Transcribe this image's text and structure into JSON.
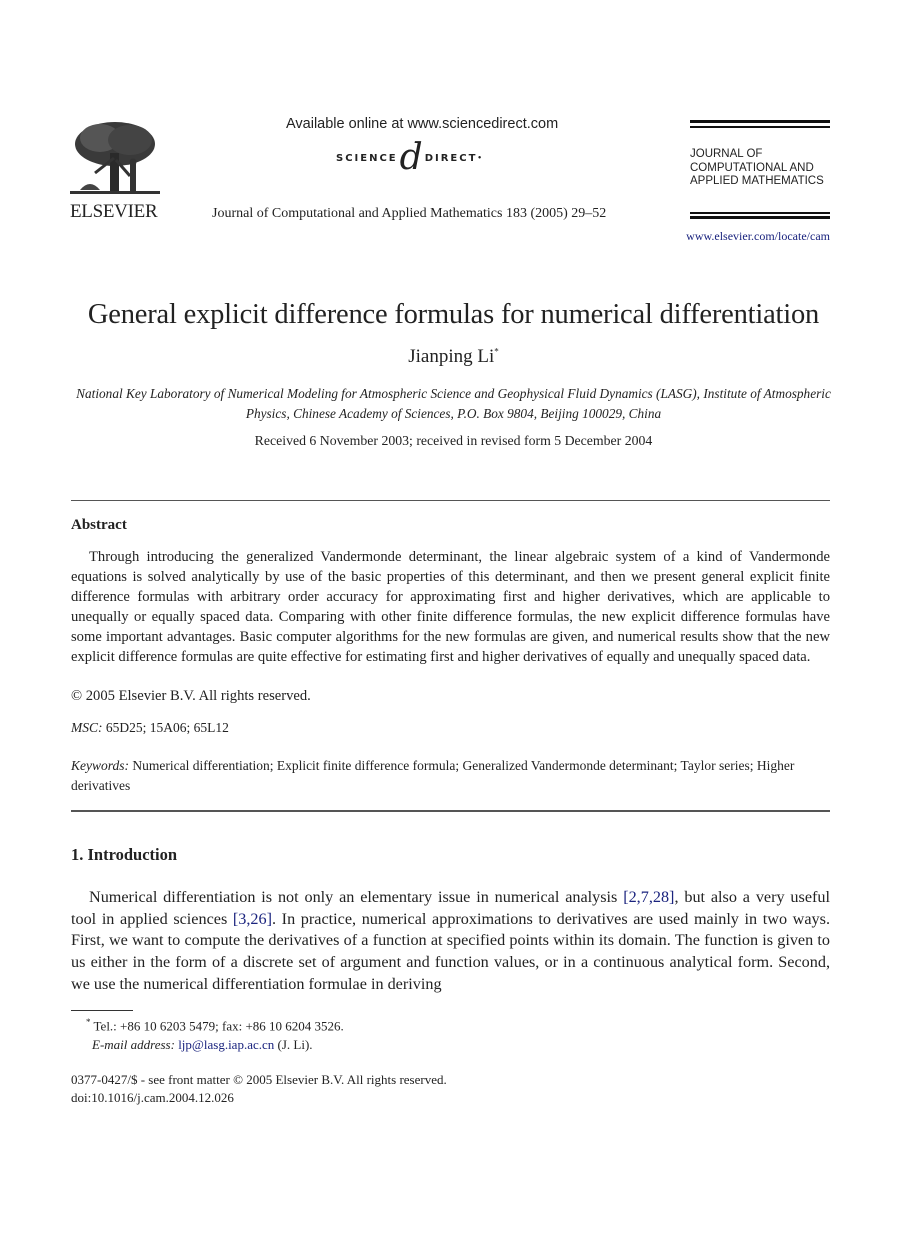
{
  "header": {
    "publisher": "ELSEVIER",
    "available_online": "Available online at www.sciencedirect.com",
    "sciencedirect_left": "SCIENCE",
    "sciencedirect_at": "d",
    "sciencedirect_right": "DIRECT",
    "sciencedirect_mark": "•",
    "journal_citation": "Journal of Computational and Applied Mathematics 183 (2005) 29–52",
    "journal_name_lines": [
      "JOURNAL OF",
      "COMPUTATIONAL AND",
      "APPLIED MATHEMATICS"
    ],
    "journal_url": "www.elsevier.com/locate/cam"
  },
  "paper": {
    "title": "General explicit difference formulas for numerical differentiation",
    "author": "Jianping Li",
    "author_mark": "*",
    "affiliation": "National Key Laboratory of Numerical Modeling for Atmospheric Science and Geophysical Fluid Dynamics (LASG), Institute of Atmospheric Physics, Chinese Academy of Sciences, P.O. Box 9804, Beijing 100029, China",
    "received": "Received 6 November 2003; received in revised form 5 December 2004"
  },
  "abstract": {
    "heading": "Abstract",
    "body": "Through introducing the generalized Vandermonde determinant, the linear algebraic system of a kind of Vandermonde equations is solved analytically by use of the basic properties of this determinant, and then we present general explicit finite difference formulas with arbitrary order accuracy for approximating first and higher derivatives, which are applicable to unequally or equally spaced data. Comparing with other finite difference formulas, the new explicit difference formulas have some important advantages. Basic computer algorithms for the new formulas are given, and numerical results show that the new explicit difference formulas are quite effective for estimating first and higher derivatives of equally and unequally spaced data.",
    "copyright": "© 2005 Elsevier B.V. All rights reserved.",
    "msc_label": "MSC:",
    "msc_value": "65D25; 15A06; 65L12",
    "keywords_label": "Keywords:",
    "keywords_value": "Numerical differentiation; Explicit finite difference formula; Generalized Vandermonde determinant; Taylor series; Higher derivatives"
  },
  "introduction": {
    "heading": "1.  Introduction",
    "text_1": "Numerical differentiation is not only an elementary issue in numerical analysis ",
    "cite_1": "[2,7,28]",
    "text_2": ", but also a very useful tool in applied sciences ",
    "cite_2": "[3,26]",
    "text_3": ". In practice, numerical approximations to derivatives are used mainly in two ways. First, we want to compute the derivatives of a function at specified points within its domain. The function is given to us either in the form of a discrete set of argument and function values, or in a continuous analytical form. Second, we use the numerical differentiation formulae in deriving"
  },
  "footnotes": {
    "tel_mark": "*",
    "tel": " Tel.: +86 10 6203 5479; fax: +86 10 6204 3526.",
    "email_label": "E-mail address:",
    "email": "ljp@lasg.iap.ac.cn",
    "email_suffix": " (J. Li).",
    "front_matter": "0377-0427/$ - see front matter © 2005 Elsevier B.V. All rights reserved.",
    "doi": "doi:10.1016/j.cam.2004.12.026"
  }
}
